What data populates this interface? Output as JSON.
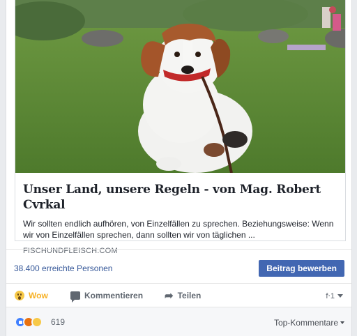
{
  "link_preview": {
    "image_alt": "Dog sitting on grass",
    "title": "Unser Land, unsere Regeln - von Mag. Robert Cvrkal",
    "description": "Wir sollten endlich aufhören, von Einzelfällen zu sprechen. Beziehungsweise: Wenn wir von Einzelfällen sprechen, dann sollten wir von täglichen ...",
    "domain": "FISCHUNDFLEISCH.COM"
  },
  "reach": {
    "text": "38.400 erreichte Personen",
    "boost_label": "Beitrag bewerben",
    "boost_color": "#4267b2"
  },
  "actions": {
    "wow_label": "Wow",
    "comment_label": "Kommentieren",
    "share_label": "Teilen",
    "selector_label": "f⋅1"
  },
  "footer": {
    "reaction_icons": [
      "like-icon",
      "angry-icon",
      "sad-icon"
    ],
    "reaction_count": "619",
    "sort_label": "Top-Kommentare"
  }
}
